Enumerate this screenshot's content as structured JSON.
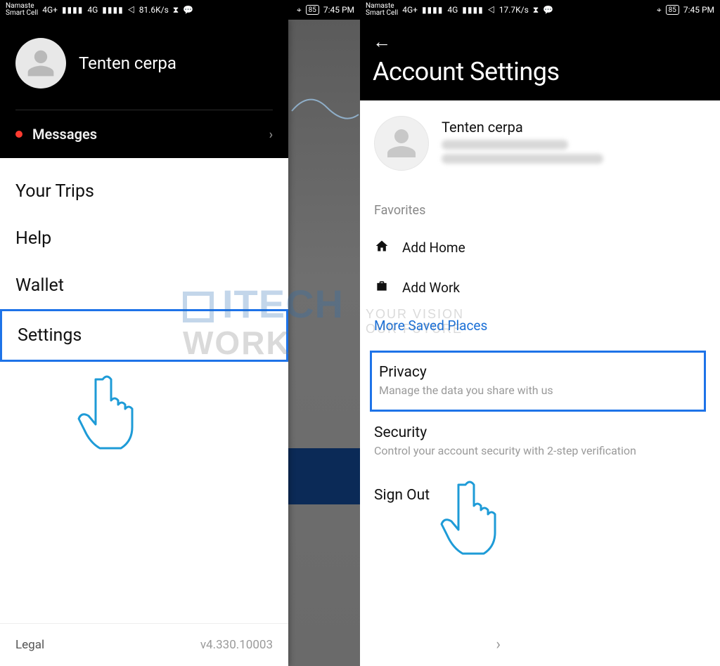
{
  "status": {
    "carrier": "Namaste\nSmart Cell",
    "net_badge_1": "4G+",
    "net_badge_2": "4G",
    "speed_left": "81.6K/s",
    "speed_right": "17.7K/s",
    "battery": "85",
    "time": "7:45 PM"
  },
  "left": {
    "profile_name": "Tenten cerpa",
    "messages_label": "Messages",
    "menu": {
      "trips": "Your Trips",
      "help": "Help",
      "wallet": "Wallet",
      "settings": "Settings"
    },
    "footer": {
      "legal": "Legal",
      "version": "v4.330.10003"
    }
  },
  "right": {
    "title": "Account Settings",
    "profile_name": "Tenten cerpa",
    "favorites_label": "Favorites",
    "add_home": "Add Home",
    "add_work": "Add Work",
    "more_places": "More Saved Places",
    "privacy": {
      "title": "Privacy",
      "desc": "Manage the data you share with us"
    },
    "security": {
      "title": "Security",
      "desc": "Control your account security with 2-step verification"
    },
    "sign_out": "Sign Out"
  },
  "watermark": {
    "line1": "ITECH",
    "line2": "WORK",
    "tag1": "YOUR VISION",
    "tag2": "OUR FUTURE"
  }
}
